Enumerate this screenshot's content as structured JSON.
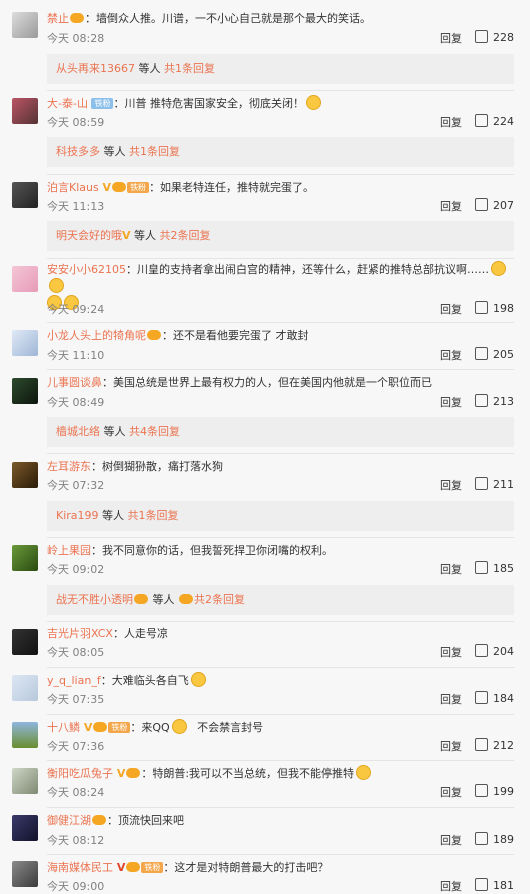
{
  "comments": [
    {
      "user": "禁止",
      "badge": "vip",
      "text": "：墙倒众人推。川谱，一不小心自己就是那个最大的笑话。",
      "time": "今天 08:28",
      "reply": "回复",
      "likes": "228",
      "sub": {
        "user": "从头再来13667",
        "mid": " 等人 ",
        "total": "共1条回复"
      }
    },
    {
      "user": "大-泰-山",
      "badge": "tag",
      "tag": "铁粉",
      "text": "：川普 推特危害国家安全，彻底关闭！",
      "emoji": true,
      "time": "今天 08:59",
      "reply": "回复",
      "likes": "224",
      "sub": {
        "user": "科技多多",
        "mid": " 等人 ",
        "total": "共1条回复"
      }
    },
    {
      "user": "泊言Klaus",
      "badge": "v",
      "tag": "铁粉",
      "text": "：如果老特连任，推特就完蛋了。",
      "time": "今天 11:13",
      "reply": "回复",
      "likes": "207",
      "sub": {
        "user": "明天会好的哦",
        "mid": " 等人 ",
        "total": "共2条回复"
      }
    },
    {
      "user": "安安小小62105",
      "text": "：川皇的支持者拿出闹白宫的精神，还等什么，赶紧的推特总部抗议啊……",
      "time": "今天 09:24",
      "reply": "回复",
      "likes": "198"
    },
    {
      "user": "小龙人头上的犄角呢",
      "badge": "vip",
      "text": "：还不是看他要完蛋了 才敢封",
      "time": "今天 11:10",
      "reply": "回复",
      "likes": "205"
    },
    {
      "user": "儿事圆谈鼻",
      "text": "：美国总统是世界上最有权力的人，但在美国内他就是一个职位而已",
      "time": "今天 08:49",
      "reply": "回复",
      "likes": "213",
      "sub": {
        "user": "樯城北络",
        "mid": " 等人 ",
        "total": "共4条回复"
      }
    },
    {
      "user": "左耳游东",
      "text": "：树倒猢狲散，痛打落水狗",
      "time": "今天 07:32",
      "reply": "回复",
      "likes": "211",
      "sub": {
        "user": "Kira199",
        "mid": " 等人 ",
        "total": "共1条回复"
      }
    },
    {
      "user": "岭上果园",
      "text": "：我不同意你的话，但我誓死捍卫你闭嘴的权利。",
      "time": "今天 09:02",
      "reply": "回复",
      "likes": "185",
      "sub": {
        "user": "战无不胜小透明",
        "mid": " 等人 ",
        "total": "共2条回复"
      }
    },
    {
      "user": "吉光片羽XCX",
      "text": "：人走号凉",
      "time": "今天 08:05",
      "reply": "回复",
      "likes": "204"
    },
    {
      "user": "y_q_lian_f",
      "text": "：大难临头各自飞",
      "time": "今天 07:35",
      "reply": "回复",
      "likes": "184"
    },
    {
      "user": "十八鳞",
      "badge": "v",
      "tag": "铁粉",
      "text": "：来QQ",
      "extra": "   不会禁言封号",
      "time": "今天 07:36",
      "reply": "回复",
      "likes": "212"
    },
    {
      "user": "衡阳吃瓜兔子",
      "badge": "v",
      "text": "：特朗普:我可以不当总统，但我不能停推特",
      "time": "今天 08:24",
      "reply": "回复",
      "likes": "199"
    },
    {
      "user": "御健江湖",
      "badge": "vip",
      "text": "：顶流快回来吧",
      "time": "今天 08:12",
      "reply": "回复",
      "likes": "189"
    },
    {
      "user": "海南媒体民工",
      "badge": "v",
      "tag": "铁粉",
      "text": "：这才是对特朗普最大的打击吧？",
      "time": "今天 09:00",
      "reply": "回复",
      "likes": "181"
    }
  ]
}
